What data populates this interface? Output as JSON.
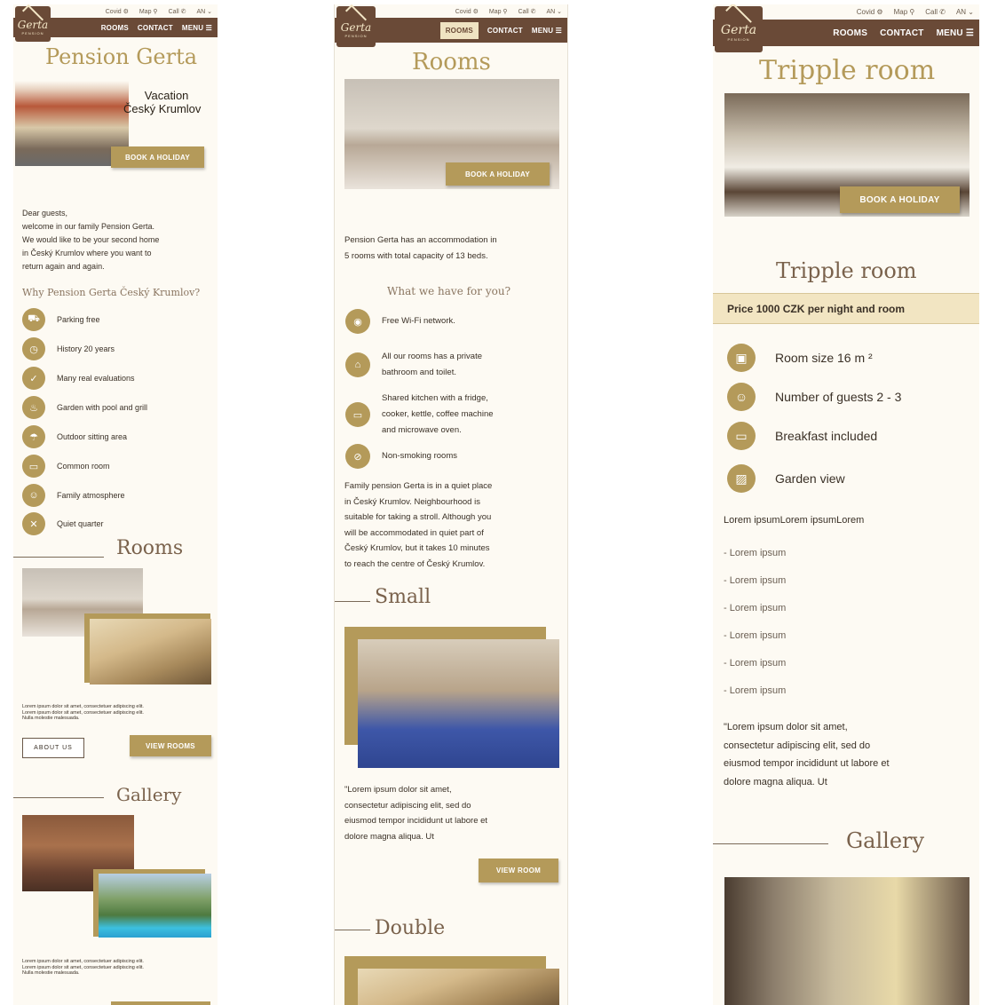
{
  "header": {
    "covid": "Covid ⚙",
    "map": "Map ⚲",
    "call": "Call ✆",
    "lang": "AN ⌄",
    "nav_rooms": "ROOMS",
    "nav_contact": "CONTACT",
    "nav_menu": "MENU ☰",
    "logo_text": "Gerta",
    "logo_sub": "PENSION"
  },
  "p1": {
    "title": "Pension Gerta",
    "hero_line1": "Vacation",
    "hero_line2": "Český Krumlov",
    "book": "BOOK A HOLIDAY",
    "welcome": [
      "Dear guests,",
      "welcome in our family Pension Gerta.",
      "We would like to be your second home",
      "in Český Krumlov where you want to",
      "return again and again."
    ],
    "why": "Why Pension Gerta Český Krumlov?",
    "features": [
      {
        "icon": "car-icon",
        "glyph": "⛟",
        "label": "Parking free"
      },
      {
        "icon": "clock-icon",
        "glyph": "◷",
        "label": "History 20 years"
      },
      {
        "icon": "thumb-icon",
        "glyph": "✓",
        "label": "Many real evaluations"
      },
      {
        "icon": "grill-icon",
        "glyph": "♨",
        "label": "Garden with pool and grill"
      },
      {
        "icon": "umbrella-icon",
        "glyph": "☂",
        "label": "Outdoor sitting area"
      },
      {
        "icon": "tv-icon",
        "glyph": "▭",
        "label": "Common room"
      },
      {
        "icon": "family-icon",
        "glyph": "☺",
        "label": "Family atmosphere"
      },
      {
        "icon": "quiet-icon",
        "glyph": "✕",
        "label": "Quiet quarter"
      }
    ],
    "rooms_title": "Rooms",
    "lorem": [
      "Lorem ipsum dolor sit amet, consectetuer adipiscing elit.",
      "Lorem ipsum dolor sit amet, consectetuer adipiscing elit.",
      "Nulla molestie malesuada."
    ],
    "about": "ABOUT US",
    "view_rooms": "VIEW ROOMS",
    "gallery_title": "Gallery",
    "lorem2": [
      "Lorem ipsum dolor sit amet, consectetuer adipiscing elit.",
      "Lorem ipsum dolor sit amet, consectetuer adipiscing elit.",
      "Nulla molestie malesuada."
    ]
  },
  "p2": {
    "title": "Rooms",
    "book": "BOOK A HOLIDAY",
    "intro": [
      "Pension Gerta has an accommodation in",
      "5 rooms with total capacity of 13 beds."
    ],
    "what": "What we have for you?",
    "features": [
      {
        "icon": "wifi-icon",
        "glyph": "◉",
        "lines": [
          "Free Wi-Fi network."
        ]
      },
      {
        "icon": "bathroom-icon",
        "glyph": "⌂",
        "lines": [
          "All our rooms has a private",
          "bathroom and toilet."
        ]
      },
      {
        "icon": "kitchen-icon",
        "glyph": "▭",
        "lines": [
          "Shared kitchen with a fridge,",
          "cooker, kettle, coffee machine",
          "and microwave oven."
        ]
      },
      {
        "icon": "no-smoking-icon",
        "glyph": "⊘",
        "lines": [
          "Non-smoking rooms"
        ]
      }
    ],
    "desc": [
      "Family pension Gerta is in a quiet place",
      "in Český Krumlov. Neighbourhood is",
      "suitable for taking a stroll. Although you",
      "will be accommodated in quiet part of",
      "Český Krumlov, but it takes 10 minutes",
      "to reach the centre of Český Krumlov."
    ],
    "small_title": "Small",
    "small_text": [
      "\"Lorem ipsum dolor sit amet,",
      "consectetur adipiscing elit, sed do",
      "eiusmod tempor incididunt ut labore et",
      "dolore magna aliqua. Ut"
    ],
    "view_room": "VIEW ROOM",
    "double_title": "Double"
  },
  "p3": {
    "title": "Tripple room",
    "book": "BOOK A HOLIDAY",
    "subtitle": "Tripple room",
    "price": "Price 1000 CZK per night and room",
    "features": [
      {
        "icon": "calendar-icon",
        "glyph": "▣",
        "label": "Room size 16 m ²"
      },
      {
        "icon": "person-icon",
        "glyph": "☺",
        "label": "Number of guests 2 - 3"
      },
      {
        "icon": "breakfast-icon",
        "glyph": "▭",
        "label": "Breakfast included"
      },
      {
        "icon": "picture-icon",
        "glyph": "▨",
        "label": "Garden view"
      }
    ],
    "lorem_head": "Lorem ipsumLorem ipsumLorem",
    "list": [
      "- Lorem ipsum",
      "- Lorem ipsum",
      "- Lorem ipsum",
      "- Lorem ipsum",
      "- Lorem ipsum",
      "- Lorem ipsum"
    ],
    "quote": [
      "\"Lorem ipsum dolor sit amet,",
      "consectetur adipiscing elit, sed do",
      "eiusmod tempor incididunt ut labore et",
      "dolore magna aliqua. Ut"
    ],
    "gallery_title": "Gallery"
  }
}
